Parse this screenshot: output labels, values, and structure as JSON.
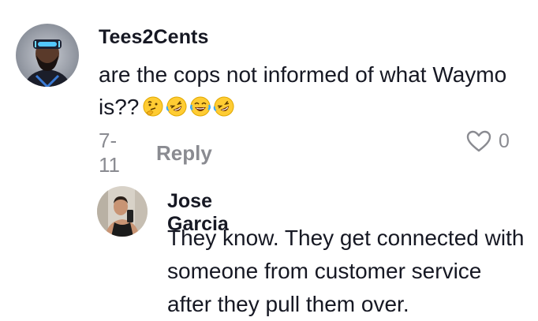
{
  "comment": {
    "username": "Tees2Cents",
    "text": "are the cops not informed of what Waymo is??",
    "emojis": [
      "thinking-face-emoji",
      "rofl-emoji",
      "joy-emoji",
      "rofl-emoji"
    ],
    "date": "7-11",
    "reply_label": "Reply",
    "like_count": "0"
  },
  "reply": {
    "username": "Jose Garcia",
    "text": "They know. They get connected with someone from customer service after they pull them over."
  },
  "colors": {
    "text": "#161823",
    "muted": "#8a8b91",
    "background": "#ffffff"
  }
}
